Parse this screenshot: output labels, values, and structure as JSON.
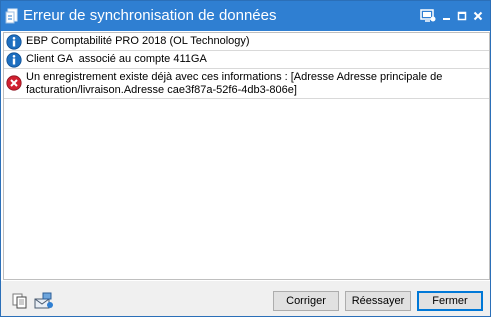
{
  "window": {
    "title": "Erreur de synchronisation de données",
    "controls": [
      {
        "name": "help-screen-icon"
      },
      {
        "name": "minimize-icon"
      },
      {
        "name": "maximize-icon"
      },
      {
        "name": "close-icon"
      }
    ]
  },
  "messages": [
    {
      "type": "info",
      "icon": "info-icon",
      "text": "EBP Comptabilité PRO 2018 (OL Technology)"
    },
    {
      "type": "info",
      "icon": "info-icon",
      "text": "Client GA  associé au compte 411GA"
    },
    {
      "type": "error",
      "icon": "error-icon",
      "text": "Un enregistrement existe déjà avec ces informations : [Adresse Adresse principale de facturation/livraison.Adresse cae3f87a-52f6-4db3-806e]"
    }
  ],
  "footer": {
    "icons": [
      "copy-icon",
      "send-mail-icon"
    ],
    "buttons": {
      "correct": "Corriger",
      "retry": "Réessayer",
      "close": "Fermer"
    }
  },
  "colors": {
    "titlebar": "#2f7fd2",
    "info": "#1e6fc0",
    "error": "#d0202f"
  }
}
